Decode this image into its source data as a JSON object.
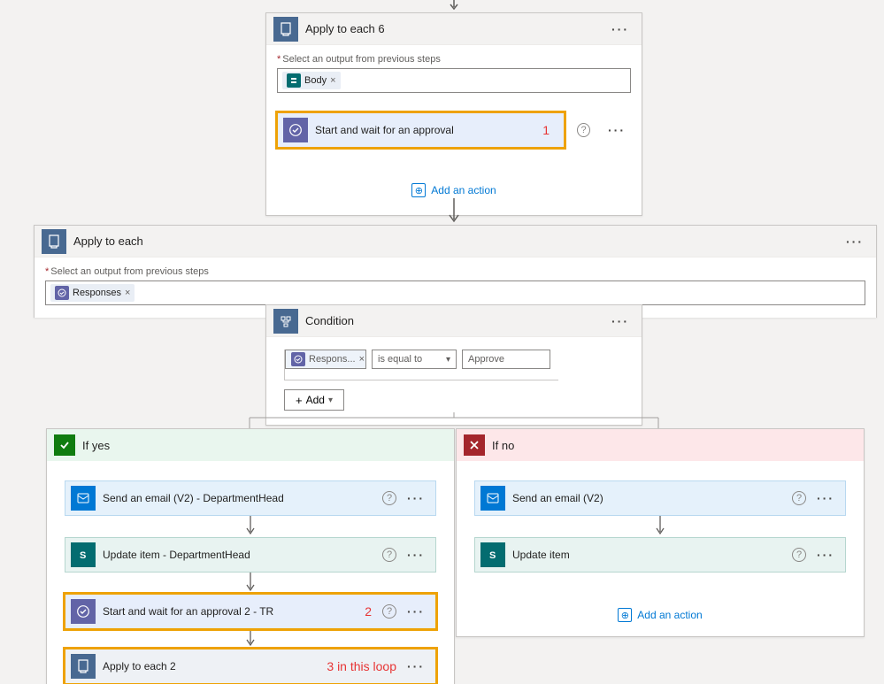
{
  "top_arrow": true,
  "each6": {
    "title": "Apply to each 6",
    "prev_label": "Select an output from previous steps",
    "token": "Body",
    "approval": {
      "title": "Start and wait for an approval",
      "annot": "1"
    },
    "add_action": "Add an action"
  },
  "each": {
    "title": "Apply to each",
    "prev_label": "Select an output from previous steps",
    "token": "Responses"
  },
  "condition": {
    "title": "Condition",
    "left_token": "Respons...",
    "operator": "is equal to",
    "right": "Approve",
    "add": "Add"
  },
  "yes": {
    "label": "If yes",
    "a1": "Send an email (V2) - DepartmentHead",
    "a2": "Update item - DepartmentHead",
    "a3": "Start and wait for an approval 2 - TR",
    "a3_annot": "2",
    "a4": "Apply to each 2",
    "a4_annot": "3 in this loop"
  },
  "no": {
    "label": "If no",
    "a1": "Send an email (V2)",
    "a2": "Update item",
    "add_action": "Add an action"
  }
}
